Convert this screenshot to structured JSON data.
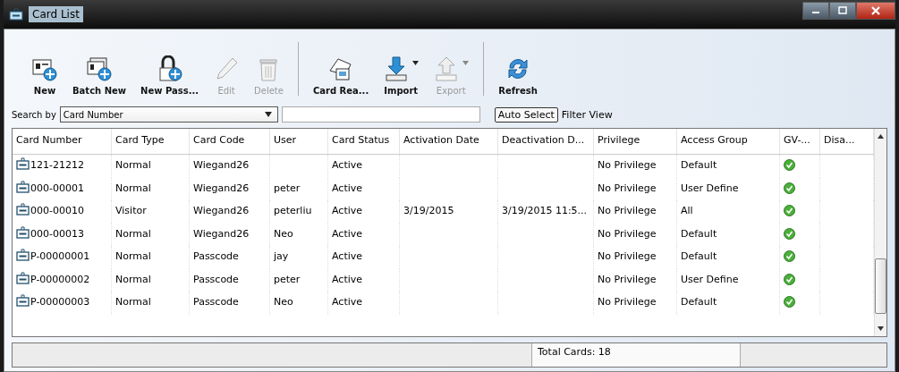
{
  "window": {
    "title": "Card List"
  },
  "toolbar": [
    [
      {
        "label": "New",
        "disabled": false,
        "has_menu": false
      },
      {
        "label": "Batch New",
        "disabled": false,
        "has_menu": false
      },
      {
        "label": "New Pass...",
        "disabled": false,
        "has_menu": false
      },
      {
        "label": "Edit",
        "disabled": true,
        "has_menu": false
      },
      {
        "label": "Delete",
        "disabled": true,
        "has_menu": false
      }
    ],
    [
      {
        "label": "Card Rea...",
        "disabled": false,
        "has_menu": false
      },
      {
        "label": "Import",
        "disabled": false,
        "has_menu": true
      },
      {
        "label": "Export",
        "disabled": true,
        "has_menu": true
      }
    ],
    [
      {
        "label": "Refresh",
        "disabled": false,
        "has_menu": false
      }
    ]
  ],
  "search": {
    "label": "Search by",
    "field": "Card Number",
    "auto_select": "Auto Select",
    "filter_view": "Filter View"
  },
  "table": {
    "columns": [
      "Card Number",
      "Card Type",
      "Card Code",
      "User",
      "Card Status",
      "Activation Date",
      "Deactivation D...",
      "Privilege",
      "Access Group",
      "GV-...",
      "Disa..."
    ],
    "rows": [
      {
        "cells": [
          "121-21212",
          "Normal",
          "Wiegand26",
          "",
          "Active",
          "",
          "",
          "No Privilege",
          "Default"
        ],
        "gv": true
      },
      {
        "cells": [
          "000-00001",
          "Normal",
          "Wiegand26",
          "peter",
          "Active",
          "",
          "",
          "No Privilege",
          "User Define"
        ],
        "gv": true
      },
      {
        "cells": [
          "000-00010",
          "Visitor",
          "Wiegand26",
          "peterliu",
          "Active",
          "3/19/2015",
          "3/19/2015 11:5...",
          "No Privilege",
          "All"
        ],
        "gv": true
      },
      {
        "cells": [
          "000-00013",
          "Normal",
          "Wiegand26",
          "Neo",
          "Active",
          "",
          "",
          "No Privilege",
          "Default"
        ],
        "gv": true
      },
      {
        "cells": [
          "P-00000001",
          "Normal",
          "Passcode",
          "jay",
          "Active",
          "",
          "",
          "No Privilege",
          "Default"
        ],
        "gv": true
      },
      {
        "cells": [
          "P-00000002",
          "Normal",
          "Passcode",
          "peter",
          "Active",
          "",
          "",
          "No Privilege",
          "User Define"
        ],
        "gv": true
      },
      {
        "cells": [
          "P-00000003",
          "Normal",
          "Passcode",
          "Neo",
          "Active",
          "",
          "",
          "No Privilege",
          "Default"
        ],
        "gv": true
      }
    ]
  },
  "status_bar": {
    "total": "Total Cards: 18"
  }
}
